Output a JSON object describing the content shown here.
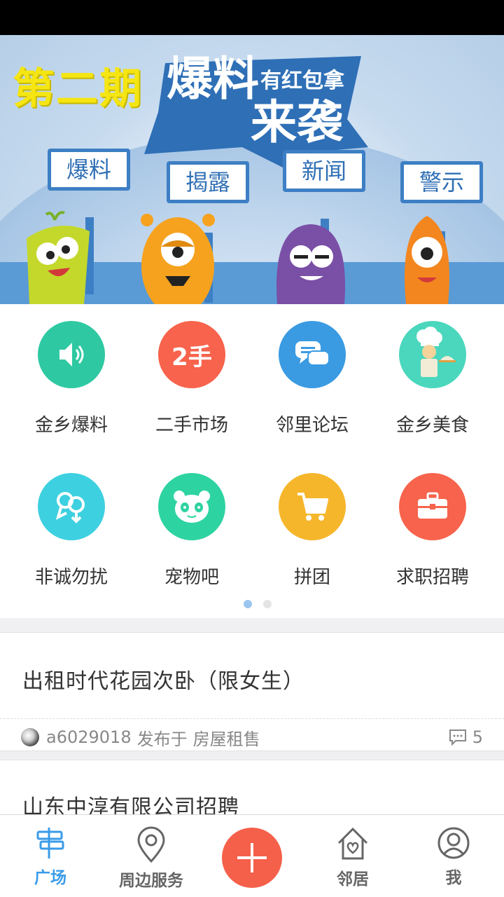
{
  "banner": {
    "issue": "第二期",
    "headline_line1": "爆料",
    "headline_line2": "来袭",
    "subtitle": "有红包拿",
    "signs": [
      "爆料",
      "揭露",
      "新闻",
      "警示"
    ],
    "slide_count": 3,
    "active_slide": 3
  },
  "grid": {
    "items": [
      {
        "label": "金乡爆料",
        "icon": "speaker-icon",
        "color": "#2ec9a2"
      },
      {
        "label": "二手市场",
        "icon": "second-hand-icon",
        "badge": "2手",
        "color": "#f7634c"
      },
      {
        "label": "邻里论坛",
        "icon": "chat-bubbles-icon",
        "color": "#3a9be2"
      },
      {
        "label": "金乡美食",
        "icon": "chef-icon",
        "color": "#4ad7bd"
      },
      {
        "label": "非诚勿扰",
        "icon": "dating-icon",
        "color": "#3dd0e0"
      },
      {
        "label": "宠物吧",
        "icon": "panda-icon",
        "color": "#2ed3a2"
      },
      {
        "label": "拼团",
        "icon": "shopping-cart-icon",
        "color": "#f6b62b"
      },
      {
        "label": "求职招聘",
        "icon": "briefcase-icon",
        "color": "#f7634c"
      }
    ],
    "page_count": 2,
    "active_page": 1
  },
  "posts": [
    {
      "title": "出租时代花园次卧（限女生）",
      "author": "a6029018",
      "published_in": "发布于",
      "category": "房屋租售",
      "comments": "5"
    },
    {
      "title": "山东中淳有限公司招聘"
    }
  ],
  "tabbar": {
    "tabs": [
      {
        "label": "广场",
        "icon": "signpost-icon",
        "active": true
      },
      {
        "label": "周边服务",
        "icon": "location-pin-icon",
        "active": false
      },
      {
        "label": "邻居",
        "icon": "home-heart-icon",
        "active": false
      },
      {
        "label": "我",
        "icon": "user-icon",
        "active": false
      }
    ],
    "fab_icon": "plus-icon",
    "active_color": "#3a9be8",
    "fab_color": "#f5604a"
  }
}
